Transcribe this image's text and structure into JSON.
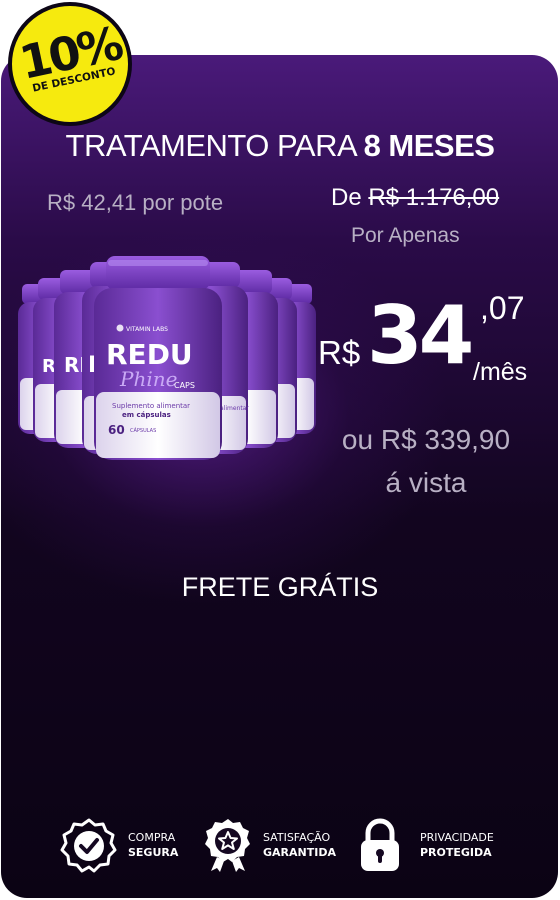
{
  "badge": {
    "percent": "10%",
    "label": "DE DESCONTO"
  },
  "offer": {
    "title_prefix": "TRATAMENTO PARA",
    "title_strong": "8 MESES",
    "per_pot": "R$ 42,41 por pote",
    "old_prefix": "De",
    "old_price": "R$ 1.176,00",
    "por_apenas": "Por Apenas"
  },
  "product": {
    "brand_line1": "REDU",
    "brand_line2": "Phine",
    "brand_line3": "CAPS",
    "count": "60",
    "bottle_count": 8
  },
  "price": {
    "currency": "R$",
    "main": "34",
    "cents": ",07",
    "unit": "/mês",
    "cash_line1": "ou R$ 339,90",
    "cash_line2": "á vista"
  },
  "shipping": "FRETE GRÁTIS",
  "trust": [
    {
      "icon": "check-badge-icon",
      "line1": "COMPRA",
      "line2": "SEGURA"
    },
    {
      "icon": "award-star-icon",
      "line1": "SATISFAÇÃO",
      "line2": "GARANTIDA"
    },
    {
      "icon": "padlock-icon",
      "line1": "PRIVACIDADE",
      "line2": "PROTEGIDA"
    }
  ],
  "colors": {
    "badge_bg": "#f6ea0e",
    "card_top": "#4a1a7a",
    "card_bottom": "#0b0314",
    "bottle_purple": "#7a3ec9",
    "muted_text": "#b8b0c4"
  }
}
